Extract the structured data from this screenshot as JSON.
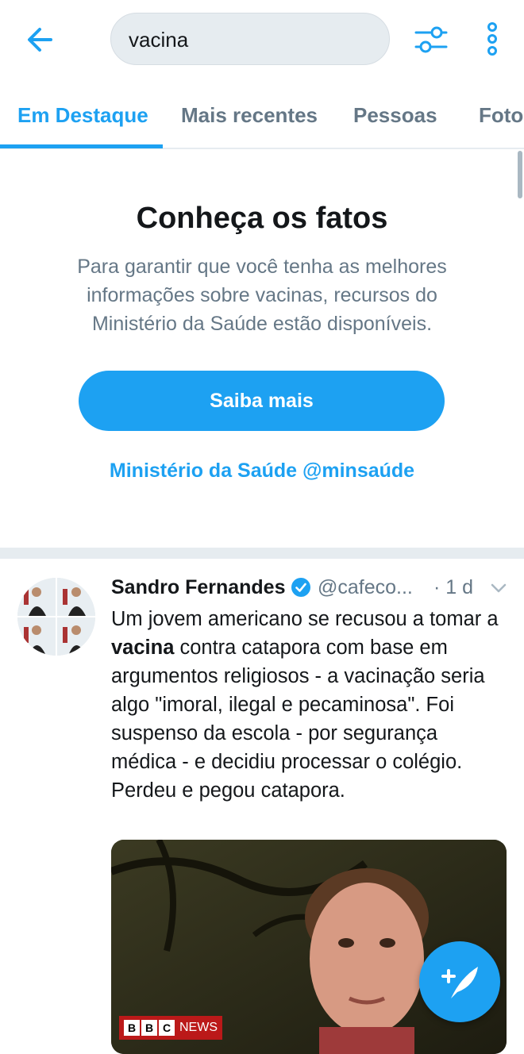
{
  "colors": {
    "accent": "#1da1f2",
    "secondary_text": "#657786",
    "divider": "#e6ecf0"
  },
  "header": {
    "back_icon": "arrow-left-icon",
    "search_value": "vacina",
    "filter_icon": "sliders-icon",
    "more_icon": "vertical-dots-icon"
  },
  "tabs": [
    {
      "label": "Em Destaque",
      "active": true
    },
    {
      "label": "Mais recentes",
      "active": false
    },
    {
      "label": "Pessoas",
      "active": false
    },
    {
      "label": "Fotos",
      "active": false
    }
  ],
  "facts": {
    "title": "Conheça os fatos",
    "body": "Para garantir que você tenha as melhores informações sobre vacinas, recursos do Ministério da Saúde estão disponíveis.",
    "button_label": "Saiba mais",
    "link_label": "Ministério da Saúde @minsaúde"
  },
  "tweet": {
    "name": "Sandro Fernandes",
    "verified_icon": "verified-badge-icon",
    "handle": "@cafeco...",
    "time": "· 1 d",
    "text_before": "Um jovem americano se recusou a tomar a ",
    "text_bold": "vacina",
    "text_after": " contra catapora com base em argumentos religiosos - a vacinação seria algo \"imoral, ilegal e pecaminosa\". Foi suspenso da escola - por segurança médica - e decidiu processar o colégio. Perdeu e pegou catapora.",
    "media_badge": {
      "b1": "B",
      "b2": "B",
      "b3": "C",
      "news": "NEWS"
    }
  },
  "fab_icon": "compose-tweet-icon"
}
